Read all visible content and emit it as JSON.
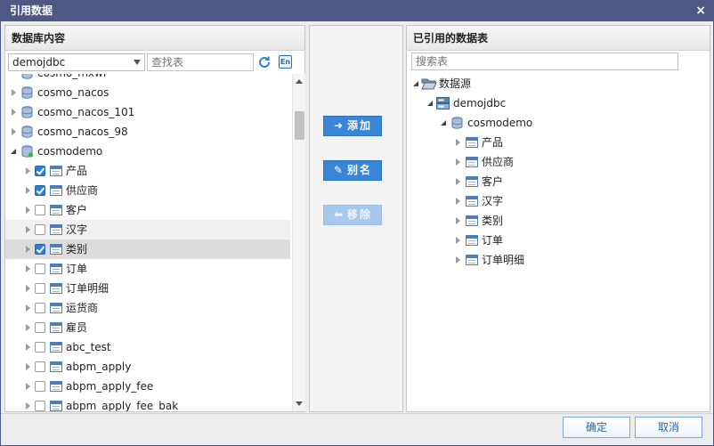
{
  "dialog": {
    "title": "引用数据",
    "close_label": "×"
  },
  "left": {
    "header": "数据库内容",
    "db_select_value": "demojdbc",
    "search_placeholder": "查找表",
    "en_label": "En",
    "partial_top_label": "cosmo_mxwl",
    "databases": [
      {
        "label": "cosmo_nacos"
      },
      {
        "label": "cosmo_nacos_101"
      },
      {
        "label": "cosmo_nacos_98"
      },
      {
        "label": "cosmodemo"
      }
    ],
    "tables": [
      {
        "label": "产品",
        "checked": true
      },
      {
        "label": "供应商",
        "checked": true
      },
      {
        "label": "客户",
        "checked": false
      },
      {
        "label": "汉字",
        "checked": false
      },
      {
        "label": "类别",
        "checked": true
      },
      {
        "label": "订单",
        "checked": false
      },
      {
        "label": "订单明细",
        "checked": false
      },
      {
        "label": "运货商",
        "checked": false
      },
      {
        "label": "雇员",
        "checked": false
      },
      {
        "label": "abc_test",
        "checked": false
      },
      {
        "label": "abpm_apply",
        "checked": false
      },
      {
        "label": "abpm_apply_fee",
        "checked": false
      },
      {
        "label": "abpm_apply_fee_bak",
        "checked": false
      }
    ]
  },
  "middle": {
    "add_label": "添加",
    "alias_label": "别名",
    "remove_label": "移除"
  },
  "right": {
    "header": "已引用的数据表",
    "search_placeholder": "搜索表",
    "root_label": "数据源",
    "datasource_label": "demojdbc",
    "db_label": "cosmodemo",
    "tables": [
      "产品",
      "供应商",
      "客户",
      "汉字",
      "类别",
      "订单",
      "订单明细"
    ]
  },
  "footer": {
    "ok_label": "确定",
    "cancel_label": "取消"
  },
  "colors": {
    "titlebar": "#4e5885",
    "button": "#3a86d6",
    "checkbox": "#2d7fd0"
  }
}
